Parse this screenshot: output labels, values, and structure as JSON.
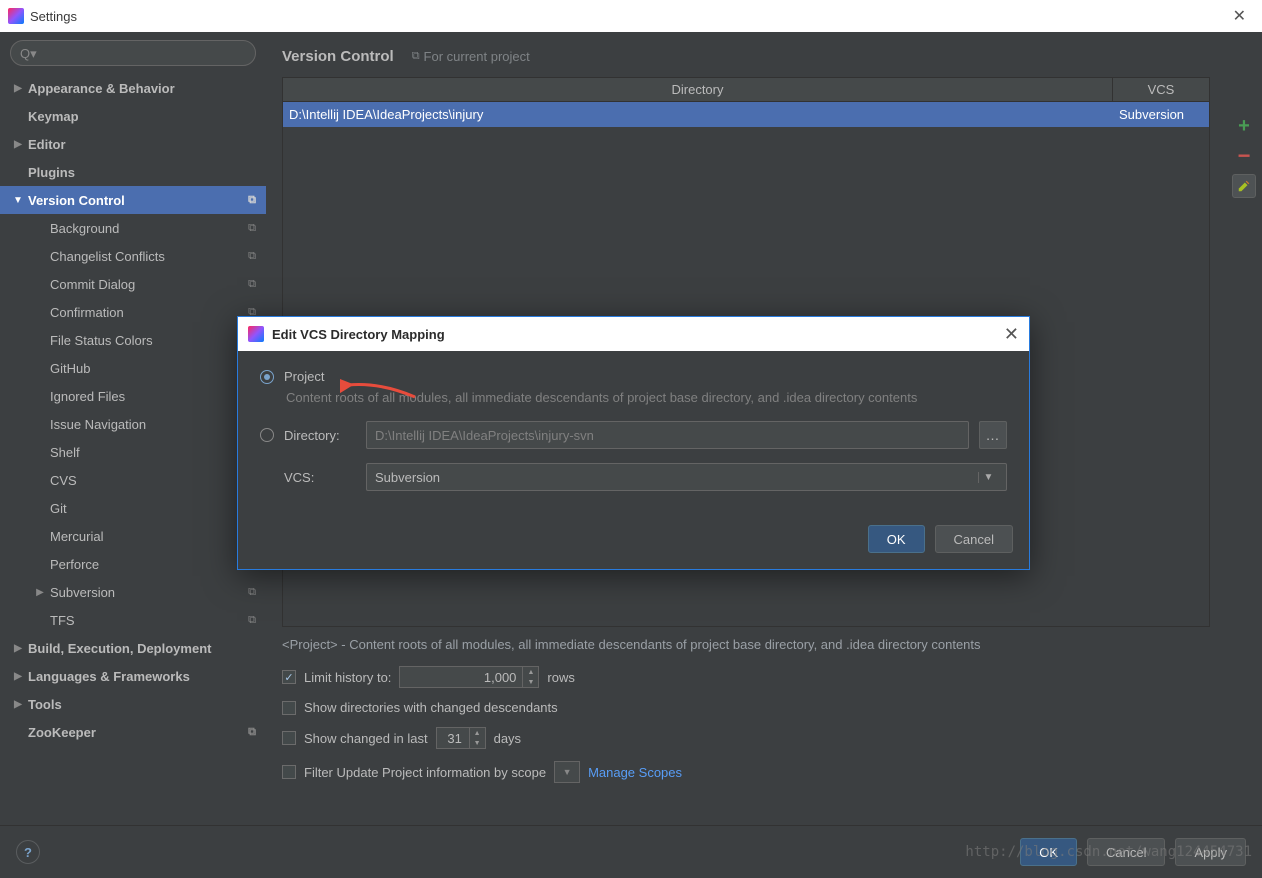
{
  "window": {
    "title": "Settings"
  },
  "search": {
    "placeholder": ""
  },
  "tree": {
    "items": [
      {
        "label": "Appearance & Behavior",
        "level": 0,
        "arrow": "▶",
        "badge": ""
      },
      {
        "label": "Keymap",
        "level": 0,
        "arrow": "",
        "badge": ""
      },
      {
        "label": "Editor",
        "level": 0,
        "arrow": "▶",
        "badge": ""
      },
      {
        "label": "Plugins",
        "level": 0,
        "arrow": "",
        "badge": ""
      },
      {
        "label": "Version Control",
        "level": 0,
        "arrow": "▼",
        "badge": "⧉",
        "selected": true
      },
      {
        "label": "Background",
        "level": 1,
        "arrow": "",
        "badge": "⧉"
      },
      {
        "label": "Changelist Conflicts",
        "level": 1,
        "arrow": "",
        "badge": "⧉"
      },
      {
        "label": "Commit Dialog",
        "level": 1,
        "arrow": "",
        "badge": "⧉"
      },
      {
        "label": "Confirmation",
        "level": 1,
        "arrow": "",
        "badge": "⧉"
      },
      {
        "label": "File Status Colors",
        "level": 1,
        "arrow": "",
        "badge": "⧉"
      },
      {
        "label": "GitHub",
        "level": 1,
        "arrow": "",
        "badge": "⧉"
      },
      {
        "label": "Ignored Files",
        "level": 1,
        "arrow": "",
        "badge": "⧉"
      },
      {
        "label": "Issue Navigation",
        "level": 1,
        "arrow": "",
        "badge": "⧉"
      },
      {
        "label": "Shelf",
        "level": 1,
        "arrow": "",
        "badge": "⧉"
      },
      {
        "label": "CVS",
        "level": 1,
        "arrow": "",
        "badge": "⧉"
      },
      {
        "label": "Git",
        "level": 1,
        "arrow": "",
        "badge": "⧉"
      },
      {
        "label": "Mercurial",
        "level": 1,
        "arrow": "",
        "badge": "⧉"
      },
      {
        "label": "Perforce",
        "level": 1,
        "arrow": "",
        "badge": "⧉"
      },
      {
        "label": "Subversion",
        "level": 1,
        "arrow": "▶",
        "badge": "⧉"
      },
      {
        "label": "TFS",
        "level": 1,
        "arrow": "",
        "badge": "⧉"
      },
      {
        "label": "Build, Execution, Deployment",
        "level": 0,
        "arrow": "▶",
        "badge": ""
      },
      {
        "label": "Languages & Frameworks",
        "level": 0,
        "arrow": "▶",
        "badge": ""
      },
      {
        "label": "Tools",
        "level": 0,
        "arrow": "▶",
        "badge": ""
      },
      {
        "label": "ZooKeeper",
        "level": 0,
        "arrow": "",
        "badge": "⧉"
      }
    ]
  },
  "content": {
    "title": "Version Control",
    "for_project": "For current project",
    "table": {
      "headers": {
        "dir": "Directory",
        "vcs": "VCS"
      },
      "row": {
        "dir": "D:\\Intellij IDEA\\IdeaProjects\\injury",
        "vcs": "Subversion"
      }
    },
    "desc": "<Project> - Content roots of all modules, all immediate descendants of project base directory, and .idea directory contents",
    "limit_label": "Limit history to:",
    "limit_value": "1,000",
    "rows_label": "rows",
    "show_dirs": "Show directories with changed descendants",
    "show_changed": "Show changed in last",
    "days_value": "31",
    "days_label": "days",
    "filter_scope": "Filter Update Project information by scope",
    "manage_scopes": "Manage Scopes"
  },
  "footer": {
    "ok": "OK",
    "cancel": "Cancel",
    "apply": "Apply"
  },
  "dialog": {
    "title": "Edit VCS Directory Mapping",
    "project": "Project",
    "hint": "Content roots of all modules, all immediate descendants of project base directory, and .idea directory contents",
    "dir_label": "Directory:",
    "dir_value": "D:\\Intellij IDEA\\IdeaProjects\\injury-svn",
    "vcs_label": "VCS:",
    "vcs_value": "Subversion",
    "ok": "OK",
    "cancel": "Cancel"
  },
  "watermark": "http://blog.csdn.net/wang124454731"
}
